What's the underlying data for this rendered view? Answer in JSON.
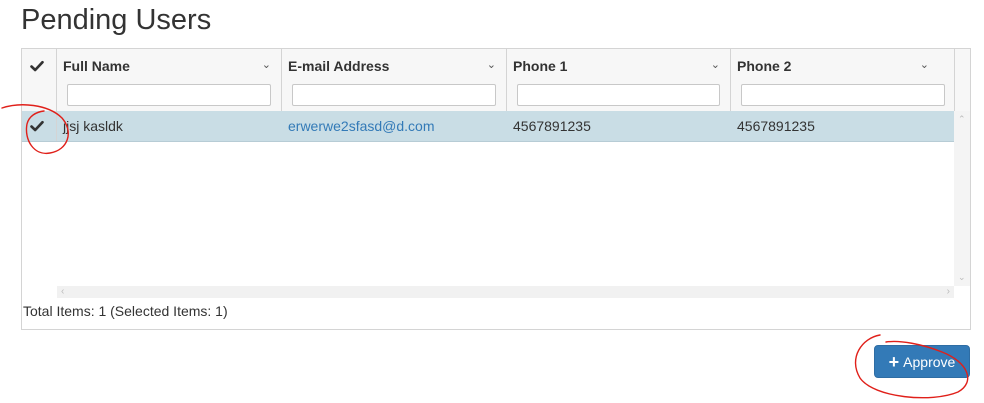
{
  "page": {
    "title": "Pending Users"
  },
  "grid": {
    "columns": [
      {
        "label": "Full Name",
        "filter_value": ""
      },
      {
        "label": "E-mail Address",
        "filter_value": ""
      },
      {
        "label": "Phone 1",
        "filter_value": ""
      },
      {
        "label": "Phone 2",
        "filter_value": ""
      }
    ],
    "rows": [
      {
        "selected": true,
        "full_name": "jjsj kasldk",
        "email": "erwerwe2sfasd@d.com",
        "phone1": "4567891235",
        "phone2": "4567891235"
      }
    ],
    "footer": "Total Items: 1 (Selected Items: 1)"
  },
  "actions": {
    "approve_label": "Approve"
  },
  "colors": {
    "accent": "#337ab7",
    "selected_row": "#c9dde5",
    "annotation": "#e0201a"
  },
  "icons": {
    "select_all": "check-icon",
    "row_select": "check-icon",
    "sort": "chevron-down-icon",
    "approve": "plus-icon"
  }
}
